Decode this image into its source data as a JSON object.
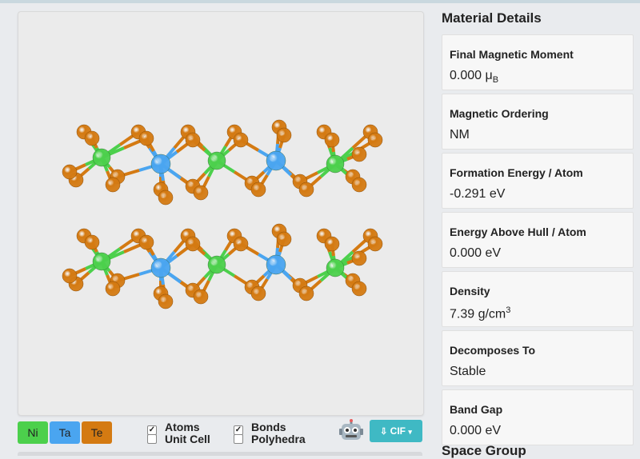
{
  "legend": [
    {
      "label": "Ni",
      "color": "#4cd04c"
    },
    {
      "label": "Ta",
      "color": "#4aa5f0"
    },
    {
      "label": "Te",
      "color": "#d47a12"
    }
  ],
  "toggles": {
    "atoms": {
      "label": "Atoms",
      "checked": true
    },
    "unit_cell": {
      "label": "Unit Cell",
      "checked": false
    },
    "bonds": {
      "label": "Bonds",
      "checked": true
    },
    "polyhedra": {
      "label": "Polyhedra",
      "checked": false
    }
  },
  "download": {
    "label": "CIF"
  },
  "material_details": {
    "title": "Material Details",
    "items": [
      {
        "label": "Final Magnetic Moment",
        "value": "0.000 μ",
        "sub": "B"
      },
      {
        "label": "Magnetic Ordering",
        "value": "NM"
      },
      {
        "label": "Formation Energy / Atom",
        "value": "-0.291 eV"
      },
      {
        "label": "Energy Above Hull / Atom",
        "value": "0.000 eV"
      },
      {
        "label": "Density",
        "value": "7.39 g/cm",
        "sup": "3"
      },
      {
        "label": "Decomposes To",
        "value": "Stable"
      },
      {
        "label": "Band Gap",
        "value": "0.000 eV"
      }
    ]
  },
  "space_group_title": "Space Group",
  "colors": {
    "ni": "#4cd04c",
    "ta": "#4aa5f0",
    "te": "#d47a12",
    "button": "#3fb9c4"
  }
}
